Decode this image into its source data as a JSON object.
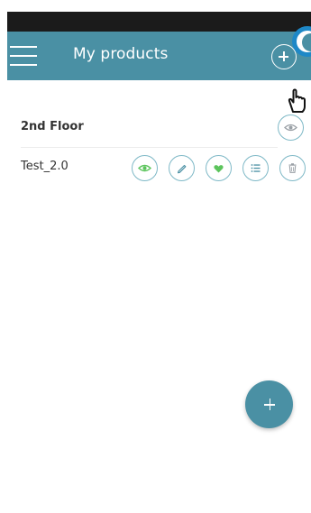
{
  "header": {
    "title": "My products",
    "menu_icon": "hamburger-menu-icon",
    "add_icon": "plus-circle-icon"
  },
  "groups": [
    {
      "name": "2nd Floor",
      "actions": [
        "eye-icon"
      ],
      "products": [
        {
          "name": "Test_2.0",
          "actions": [
            "eye-icon",
            "pencil-icon",
            "heart-icon",
            "list-icon",
            "trash-icon"
          ]
        }
      ]
    }
  ],
  "fab": {
    "icon": "plus-icon"
  },
  "colors": {
    "primary": "#4a90a4",
    "accent_green": "#5cc45c",
    "highlight_blue": "#1e88c7",
    "status_bar": "#1b1b1b",
    "text": "#333333"
  }
}
